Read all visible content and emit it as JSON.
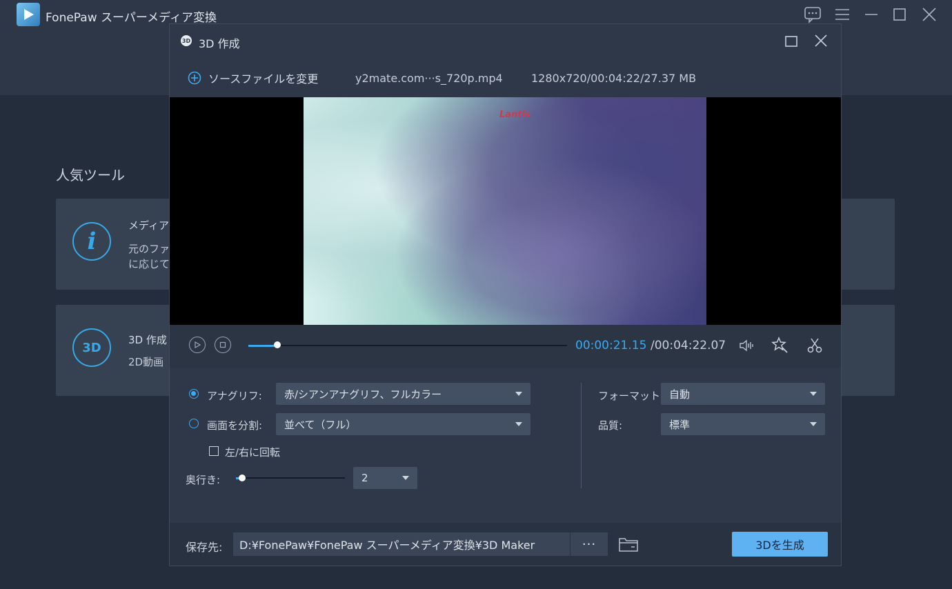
{
  "app": {
    "title": "FonePaw スーパーメディア変換",
    "window_icons": [
      "feedback-icon",
      "menu-icon",
      "minimize-icon",
      "maximize-icon",
      "close-icon"
    ]
  },
  "home": {
    "popular_title": "人気ツール",
    "tools": [
      {
        "icon_text": "i",
        "name": "メディアメ",
        "desc_lines": [
          "元のファイ",
          "に応じて変"
        ]
      },
      {
        "icon_text": "3D",
        "name": "3D 作成",
        "desc_lines": [
          "2D動画"
        ]
      }
    ]
  },
  "dialog": {
    "title_icon_text": "3D",
    "title": "3D 作成",
    "change_source_label": "ソースファイルを変更",
    "file_name": "y2mate.com···s_720p.mp4",
    "file_info": "1280x720/00:04:22/27.37 MB",
    "video_logo": "Lantis",
    "player": {
      "time_current": "00:00:21.15",
      "time_total": "/00:04:22.07",
      "progress": 0.09
    },
    "settings": {
      "anaglyph_label": "アナグリフ:",
      "anaglyph_value": "赤/シアンアナグリフ、フルカラー",
      "anaglyph_selected": true,
      "split_label": "画面を分割:",
      "split_value": "並べて（フル）",
      "split_selected": false,
      "rotate_label": "左/右に回転",
      "rotate_checked": false,
      "depth_label": "奥行き:",
      "depth_value": "2",
      "format_label": "フォーマット:",
      "format_value": "自動",
      "quality_label": "品質:",
      "quality_value": "標準"
    },
    "footer": {
      "save_label": "保存先:",
      "save_path": "D:¥FonePaw¥FonePaw スーパーメディア変換¥3D Maker",
      "browse_label": "···",
      "generate_label": "3Dを生成"
    }
  }
}
